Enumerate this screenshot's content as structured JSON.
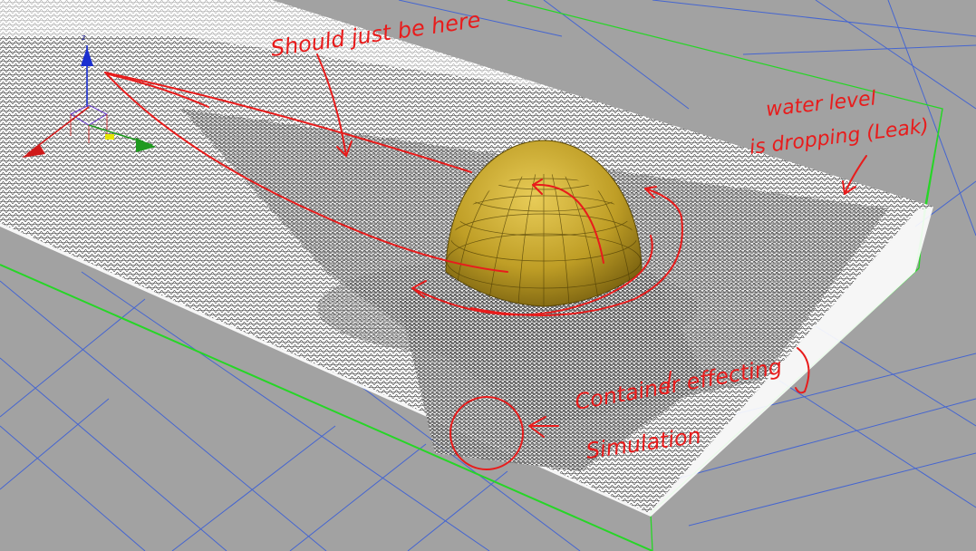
{
  "viewport": {
    "background": "#a2a2a2",
    "grid_color": "#3b5fd6",
    "container_color": "#26d626",
    "mesh_color": "#ffffff",
    "sphere_color": "#c7a72a",
    "annotation_color": "#e81c1c"
  },
  "gizmo": {
    "z_label": "z",
    "x_color": "#d01a1a",
    "y_color": "#1f9a1f",
    "z_color": "#1a2fd0"
  },
  "annotations": {
    "note_top": "Should just be here",
    "note_water_line1": "water level",
    "note_water_line2": "is dropping (Leak)",
    "note_container_line1": "Container effecting",
    "note_container_line2": "Simulation"
  }
}
